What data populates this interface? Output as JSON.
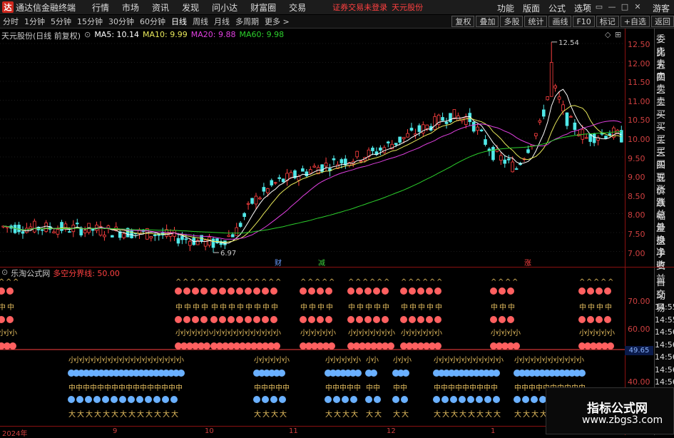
{
  "app": {
    "logo": "达",
    "title": "通达信金融终端",
    "notice": "证券交易未登录",
    "stock_tag": "天元股份",
    "guest": "游客"
  },
  "menu": [
    "行情",
    "市场",
    "资讯",
    "发现",
    "问小达",
    "财富圈",
    "交易"
  ],
  "right_menu": [
    "功能",
    "版面",
    "公式",
    "选项"
  ],
  "window_buttons": [
    "refresh-icon",
    "fullscreen-icon",
    "minimize-icon",
    "maximize-icon",
    "close-icon"
  ],
  "periods": [
    "分时",
    "1分钟",
    "5分钟",
    "15分钟",
    "30分钟",
    "60分钟",
    "日线",
    "周线",
    "月线",
    "多周期",
    "更多 >"
  ],
  "active_period": "日线",
  "toolbar_right": [
    "复权",
    "叠加",
    "多股",
    "统计",
    "画线",
    "F10",
    "标记",
    "+自选",
    "返回"
  ],
  "stock_info": {
    "name": "天元股份(日线 前复权)",
    "ma5": "MA5: 10.14",
    "ma10": "MA10: 9.99",
    "ma20": "MA20: 9.88",
    "ma60": "MA60: 9.98"
  },
  "main_y_ticks": [
    "12.50",
    "12.00",
    "11.50",
    "11.00",
    "10.50",
    "10.00",
    "9.50",
    "9.00",
    "8.50",
    "8.00",
    "7.50",
    "7.00"
  ],
  "high_label": "12.54",
  "low_label": "6.97",
  "markers": {
    "cai": "财",
    "jian": "减",
    "zhang": "涨"
  },
  "side_panel": [
    "委比",
    "卖五",
    "卖四",
    "卖三",
    "卖二",
    "卖一",
    "买一",
    "买二",
    "买三",
    "买四",
    "买五",
    "现价",
    "涨跌",
    "涨幅",
    "总量",
    "外盘",
    "换手",
    "净资",
    "收益"
  ],
  "side_panel2": [
    "自动",
    "交易"
  ],
  "side_times": [
    "14:55",
    "14:55",
    "14:56",
    "14:56",
    "14:56",
    "14:56",
    "14:56",
    "14:56"
  ],
  "sub_info": {
    "name": "乐淘公式网",
    "line": "多空分界线: 50.00"
  },
  "sub_y_ticks": [
    "70.00",
    "60.00",
    "40.00"
  ],
  "sub_value": "49.65",
  "dates": [
    "2024年",
    "9",
    "10",
    "11",
    "12",
    "1"
  ],
  "watermark": {
    "line1": "指标公式网",
    "line2": "www.zbgs3.com"
  },
  "colors": {
    "ma5": "#ffffff",
    "ma10": "#e8e85a",
    "ma20": "#e040e0",
    "ma60": "#2cd02c",
    "up": "#ff4040",
    "down": "#50e8e8",
    "axis": "#8a1010"
  }
}
